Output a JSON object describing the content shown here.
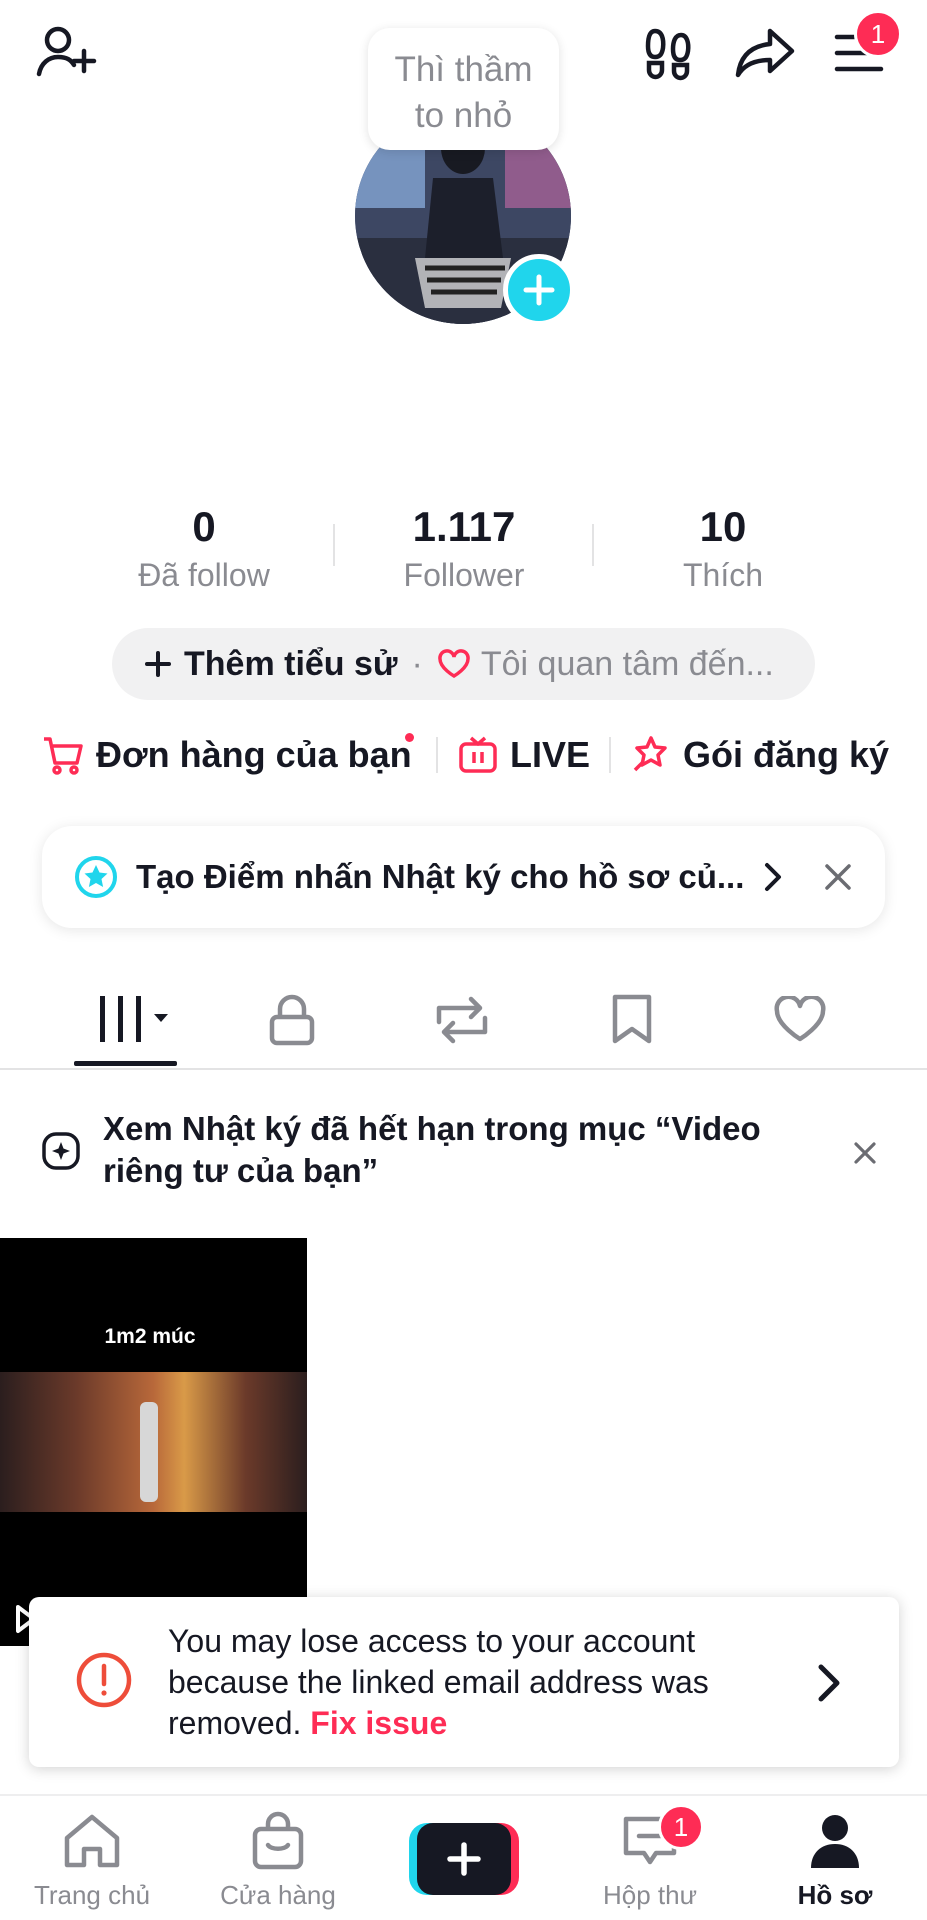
{
  "header": {
    "tooltip": "Thì thầm to nhỏ",
    "tooltip_line1": "Thì thầm",
    "tooltip_line2": "to nhỏ",
    "menu_badge": "1",
    "icons": [
      "add-user-icon",
      "footprints-icon",
      "share-icon",
      "menu-icon"
    ]
  },
  "stats": [
    {
      "value": "0",
      "label": "Đã follow"
    },
    {
      "value": "1.117",
      "label": "Follower"
    },
    {
      "value": "10",
      "label": "Thích"
    }
  ],
  "bio": {
    "add_label": "Thêm tiểu sử",
    "separator": "·",
    "interest_placeholder": "Tôi quan tâm đến..."
  },
  "quick_links": {
    "orders": "Đơn hàng của bạn",
    "live": "LIVE",
    "subscription": "Gói đăng ký"
  },
  "highlight_card": {
    "text": "Tạo Điểm nhấn Nhật ký cho hồ sơ củ..."
  },
  "tabs": [
    "videos-grid",
    "private",
    "reposts",
    "saved",
    "liked"
  ],
  "notice": {
    "text": "Xem Nhật ký đã hết hạn trong mục “Video riêng tư của bạn”"
  },
  "video": {
    "title": "1m2 múc"
  },
  "alert": {
    "message": "You may lose access to your account because the linked email address was removed.",
    "fix_label": "Fix issue"
  },
  "bottom_nav": {
    "home": "Trang chủ",
    "shop": "Cửa hàng",
    "inbox": "Hộp thư",
    "inbox_badge": "1",
    "profile": "Hồ sơ"
  },
  "colors": {
    "accent": "#fe2c55",
    "cyan": "#20d5ec",
    "text": "#161823",
    "muted": "#8a8b91"
  }
}
